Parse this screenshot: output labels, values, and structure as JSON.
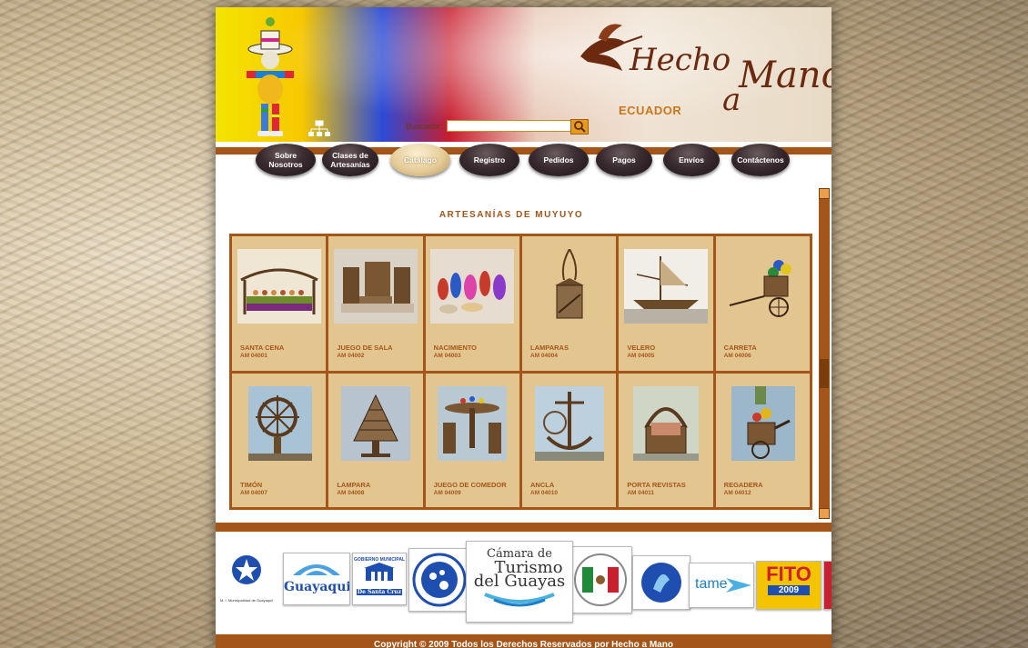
{
  "header": {
    "logo_main": "Hecho",
    "logo_a": "a",
    "logo_mano": "Mano",
    "logo_country": "ECUADOR",
    "search_label": "Buscador:"
  },
  "nav": [
    {
      "label": "Sobre Nosotros",
      "active": false
    },
    {
      "label": "Clases de Artesanías",
      "active": false
    },
    {
      "label": "Catálago",
      "active": true
    },
    {
      "label": "Registro",
      "active": false
    },
    {
      "label": "Pedidos",
      "active": false
    },
    {
      "label": "Pagos",
      "active": false
    },
    {
      "label": "Envíos",
      "active": false
    },
    {
      "label": "Contáctenos",
      "active": false
    }
  ],
  "section_title": "ARTESANÍAS DE MUYUYO",
  "products": [
    {
      "name": "SANTA CENA",
      "code": "AM 04001"
    },
    {
      "name": "JUEGO DE SALA",
      "code": "AM 04002"
    },
    {
      "name": "NACIMIENTO",
      "code": "AM 04003"
    },
    {
      "name": "LAMPARAS",
      "code": "AM 04004"
    },
    {
      "name": "VELERO",
      "code": "AM 04005"
    },
    {
      "name": "CARRETA",
      "code": "AM 04006"
    },
    {
      "name": "TIMÓN",
      "code": "AM 04007"
    },
    {
      "name": "LAMPARA",
      "code": "AM 04008"
    },
    {
      "name": "JUEGO DE COMEDOR",
      "code": "AM 04009"
    },
    {
      "name": "ANCLA",
      "code": "AM 04010"
    },
    {
      "name": "PORTA REVISTAS",
      "code": "AM 04011"
    },
    {
      "name": "REGADERA",
      "code": "AM 04012"
    }
  ],
  "sponsors": {
    "guayaquil": "Guayaquil",
    "santa_cruz_top": "GOBIERNO MUNICIPAL",
    "santa_cruz_bottom": "De Santa Cruz",
    "camara_line1": "Cámara de",
    "camara_line2": "Turismo",
    "camara_line3": "del Guayas",
    "tame": "tame",
    "fito": "FITO",
    "fito_year": "2009",
    "municipio": "M. I. Municipalidad de Guayaquil"
  },
  "copyright": "Copyright © 2009 Todos los Derechos Reservados por Hecho a Mano",
  "colors": {
    "brand_brown": "#a4561a",
    "tile_beige": "#e3c590",
    "accent_orange": "#e89a1c"
  }
}
